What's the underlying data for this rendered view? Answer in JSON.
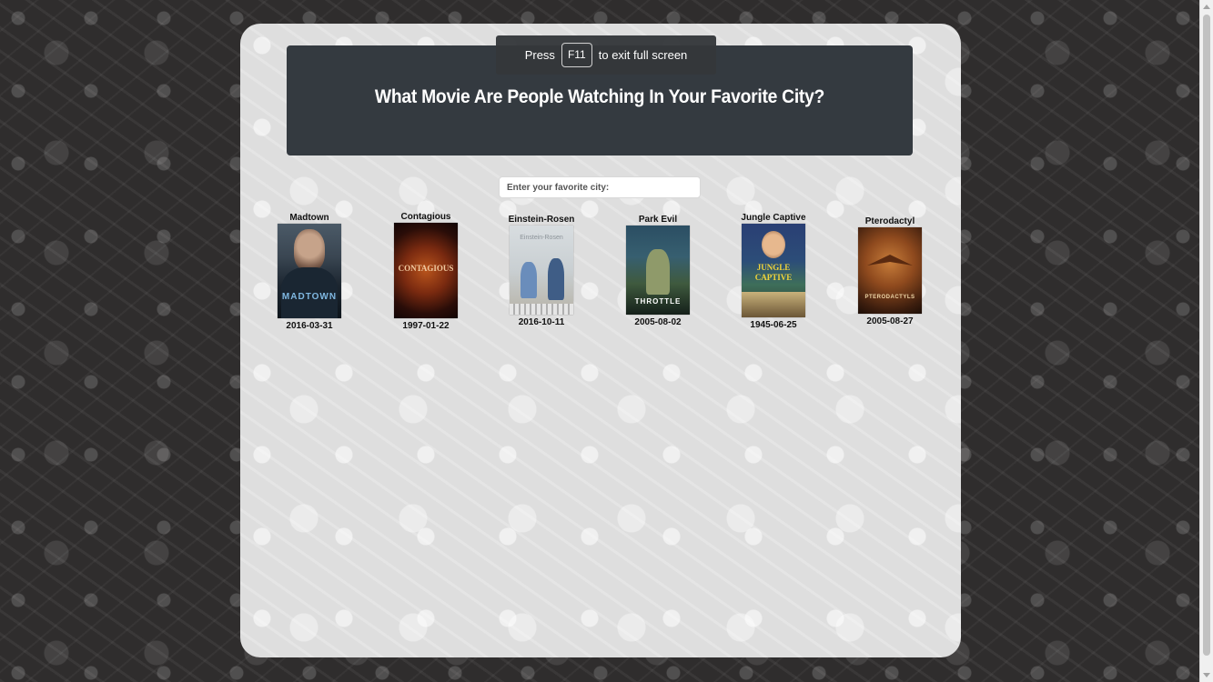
{
  "header": {
    "title": "What Movie Are People Watching In Your Favorite City?"
  },
  "search": {
    "placeholder": "Enter your favorite city:",
    "value": ""
  },
  "fullscreen_notice": {
    "prefix": "Press",
    "key": "F11",
    "suffix": "to exit full screen"
  },
  "movies": [
    {
      "title": "Madtown",
      "date": "2016-03-31",
      "poster_text": "MADTOWN"
    },
    {
      "title": "Contagious",
      "date": "1997-01-22",
      "poster_text": "CONTAGIOUS"
    },
    {
      "title": "Einstein-Rosen",
      "date": "2016-10-11",
      "poster_text": "Einstein-Rosen"
    },
    {
      "title": "Park Evil",
      "date": "2005-08-02",
      "poster_text": "THROTTLE"
    },
    {
      "title": "Jungle Captive",
      "date": "1945-06-25",
      "poster_text_1": "JUNGLE",
      "poster_text_2": "CAPTIVE"
    },
    {
      "title": "Pterodactyl",
      "date": "2005-08-27",
      "poster_text": "PTERODACTYLS"
    }
  ],
  "colors": {
    "header_bg": "#343a40",
    "page_bg": "#2f2d2d",
    "panel_bg": "#dedede"
  }
}
